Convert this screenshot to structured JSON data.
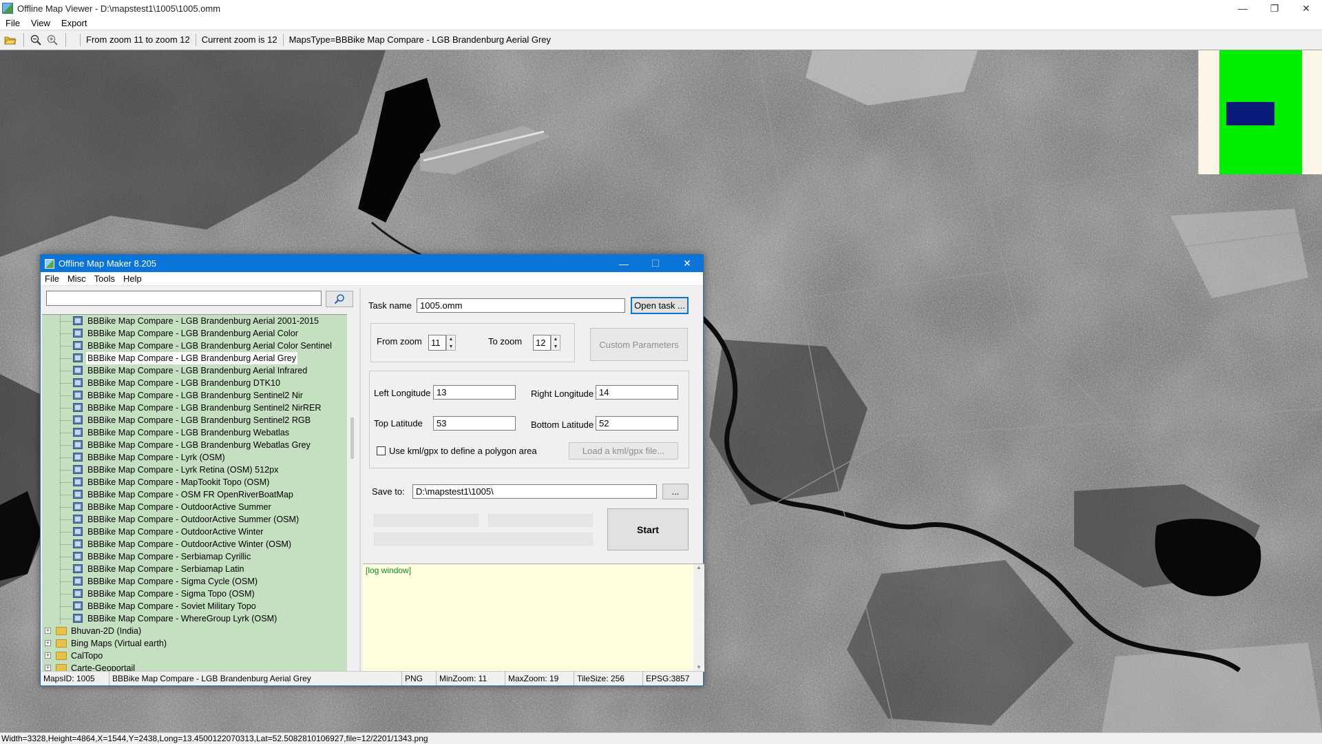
{
  "window": {
    "title": "Offline Map Viewer - D:\\mapstest1\\1005\\1005.omm",
    "controls": {
      "minimize": "—",
      "restore": "❐",
      "close": "✕"
    }
  },
  "menu": [
    "File",
    "View",
    "Export"
  ],
  "toolbar": {
    "zoom_range": "From zoom 11 to zoom 12",
    "current_zoom": "Current zoom is 12",
    "maps_type": "MapsType=BBBike Map Compare - LGB Brandenburg Aerial Grey"
  },
  "statusbar": {
    "text": "Width=3328,Height=4864,X=1544,Y=2438,Long=13.4500122070313,Lat=52.5082810106927,file=12/2201/1343.png"
  },
  "dialog": {
    "title": "Offline Map Maker 8.205",
    "controls": {
      "minimize": "—",
      "maximize": "☐",
      "close": "✕"
    },
    "menu": [
      "File",
      "Misc",
      "Tools",
      "Help"
    ],
    "search": {
      "value": "",
      "placeholder": ""
    },
    "tree": {
      "leaves": [
        {
          "label": "BBBike Map Compare - LGB Brandenburg Aerial 2001-2015",
          "selected": false
        },
        {
          "label": "BBBike Map Compare - LGB Brandenburg Aerial Color",
          "selected": false
        },
        {
          "label": "BBBike Map Compare - LGB Brandenburg Aerial Color Sentinel",
          "selected": false
        },
        {
          "label": "BBBike Map Compare - LGB Brandenburg Aerial Grey",
          "selected": true
        },
        {
          "label": "BBBike Map Compare - LGB Brandenburg Aerial Infrared",
          "selected": false
        },
        {
          "label": "BBBike Map Compare - LGB Brandenburg DTK10",
          "selected": false
        },
        {
          "label": "BBBike Map Compare - LGB Brandenburg Sentinel2 Nir",
          "selected": false
        },
        {
          "label": "BBBike Map Compare - LGB Brandenburg Sentinel2 NirRER",
          "selected": false
        },
        {
          "label": "BBBike Map Compare - LGB Brandenburg Sentinel2 RGB",
          "selected": false
        },
        {
          "label": "BBBike Map Compare - LGB Brandenburg Webatlas",
          "selected": false
        },
        {
          "label": "BBBike Map Compare - LGB Brandenburg Webatlas Grey",
          "selected": false
        },
        {
          "label": "BBBike Map Compare - Lyrk (OSM)",
          "selected": false
        },
        {
          "label": "BBBike Map Compare - Lyrk Retina (OSM) 512px",
          "selected": false
        },
        {
          "label": "BBBike Map Compare - MapTookit Topo (OSM)",
          "selected": false
        },
        {
          "label": "BBBike Map Compare - OSM FR OpenRiverBoatMap",
          "selected": false
        },
        {
          "label": "BBBike Map Compare - OutdoorActive Summer",
          "selected": false
        },
        {
          "label": "BBBike Map Compare - OutdoorActive Summer (OSM)",
          "selected": false
        },
        {
          "label": "BBBike Map Compare - OutdoorActive Winter",
          "selected": false
        },
        {
          "label": "BBBike Map Compare - OutdoorActive Winter (OSM)",
          "selected": false
        },
        {
          "label": "BBBike Map Compare - Serbiamap Cyrillic",
          "selected": false
        },
        {
          "label": "BBBike Map Compare - Serbiamap Latin",
          "selected": false
        },
        {
          "label": "BBBike Map Compare - Sigma Cycle (OSM)",
          "selected": false
        },
        {
          "label": "BBBike Map Compare - Sigma Topo (OSM)",
          "selected": false
        },
        {
          "label": "BBBike Map Compare - Soviet Military Topo",
          "selected": false
        },
        {
          "label": "BBBike Map Compare - WhereGroup Lyrk (OSM)",
          "selected": false
        }
      ],
      "folders": [
        {
          "label": "Bhuvan-2D (India)",
          "expander": "+"
        },
        {
          "label": "Bing Maps (Virtual earth)",
          "expander": "+"
        },
        {
          "label": "CalTopo",
          "expander": "+"
        },
        {
          "label": "Carte-Geoportail",
          "expander": "+"
        }
      ]
    },
    "task": {
      "name_label": "Task name",
      "name_value": "1005.omm",
      "open_button": "Open task ..."
    },
    "zoom": {
      "from_label": "From zoom",
      "from_value": "11",
      "to_label": "To zoom",
      "to_value": "12",
      "custom_button": "Custom Parameters"
    },
    "area": {
      "left_lon_label": "Left Longitude",
      "left_lon_value": "13",
      "right_lon_label": "Right Longitude",
      "right_lon_value": "14",
      "top_lat_label": "Top Latitude",
      "top_lat_value": "53",
      "bottom_lat_label": "Bottom Latitude",
      "bottom_lat_value": "52",
      "kml_checkbox_label": "Use kml/gpx to define a polygon area",
      "kml_checked": false,
      "kml_button": "Load a kml/gpx file..."
    },
    "save": {
      "label": "Save to:",
      "value": "D:\\mapstest1\\1005\\",
      "browse_button": "..."
    },
    "start_button": "Start",
    "log": {
      "text": "[log window]"
    },
    "status": {
      "maps_id": "MapsID: 1005",
      "maps_name": "BBBike Map Compare - LGB Brandenburg Aerial Grey",
      "format": "PNG",
      "min_zoom": "MinZoom: 11",
      "max_zoom": "MaxZoom: 19",
      "tile_size": "TileSize: 256",
      "epsg": "EPSG:3857"
    }
  },
  "colors": {
    "dialog_title": "#0a74d8",
    "tree_background": "#c5dfc1",
    "log_background": "#ffffe0",
    "log_text": "#0a8a20",
    "minimap_green": "#00ee00",
    "minimap_viewport": "#0a1a78"
  },
  "icons": [
    "open-folder-icon",
    "zoom-out-icon",
    "zoom-in-icon",
    "search-icon",
    "map-layer-icon",
    "folder-icon"
  ]
}
